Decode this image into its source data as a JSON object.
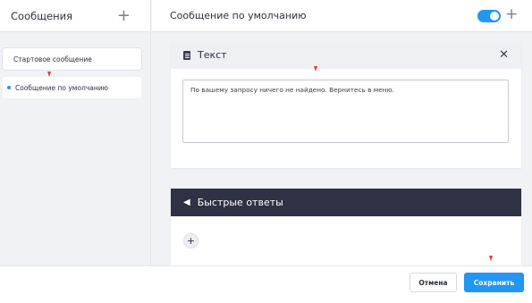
{
  "sidebar": {
    "title": "Сообщения",
    "add": "+",
    "items": [
      {
        "label": "Стартовое сообщение",
        "active": false
      },
      {
        "label": "Сообщение по умолчанию",
        "active": true
      }
    ]
  },
  "header": {
    "title": "Сообщение по умолчанию",
    "toggle_on": true,
    "add": "+"
  },
  "text_card": {
    "title": "Текст",
    "close": "✕",
    "value": "По вашему запросу ничего не найдено. Вернитесь в меню."
  },
  "quick_replies": {
    "title": "Быстрые ответы",
    "reply_icon": "◀",
    "add": "+"
  },
  "footer": {
    "cancel_label": "Отмена",
    "save_label": "Сохранить"
  },
  "colors": {
    "accent": "#2196f3",
    "dark_header": "#2f3144",
    "marker": "#e53935"
  }
}
